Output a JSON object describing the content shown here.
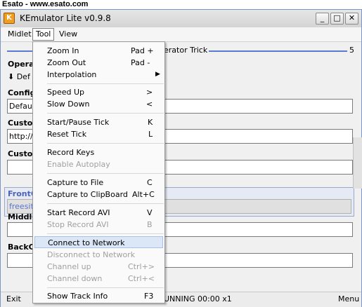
{
  "header": {
    "source": "Esato - www.esato.com"
  },
  "window": {
    "title": "KEmulator Lite v0.9.8",
    "app_icon": "K",
    "controls": {
      "minimize": "_",
      "maximize": "□",
      "close": "✕"
    }
  },
  "menubar": {
    "midlet": "Midlet",
    "tool": "Tool",
    "view": "View"
  },
  "content": {
    "slider_label": "erator Trick",
    "slider_value": "5",
    "operator_label": "Opera",
    "operator_sub": "⬇ Def",
    "config_label": "Config",
    "config_value": "Defau",
    "custom1_label": "Custon",
    "custom1_value": "http://fr",
    "custom2_label": "Custor",
    "custom2_value": "",
    "front_label": "FrontC",
    "front_value": "freesit",
    "middle_label": "Middle",
    "middle_value": "",
    "back_label": "BackC",
    "back_value": ""
  },
  "statusbar": {
    "left": "Exit",
    "center": "UNNING 00:00 x1",
    "right": "Menu"
  },
  "tool_menu": {
    "items": [
      {
        "label": "Zoom In",
        "shortcut": "Pad +"
      },
      {
        "label": "Zoom Out",
        "shortcut": "Pad -"
      },
      {
        "label": "Interpolation",
        "shortcut": ""
      },
      {
        "label": "Speed Up",
        "shortcut": ">"
      },
      {
        "label": "Slow Down",
        "shortcut": "<"
      },
      {
        "label": "Start/Pause Tick",
        "shortcut": "K"
      },
      {
        "label": "Reset Tick",
        "shortcut": "L"
      },
      {
        "label": "Record Keys",
        "shortcut": ""
      },
      {
        "label": "Enable Autoplay",
        "shortcut": ""
      },
      {
        "label": "Capture to File",
        "shortcut": "C"
      },
      {
        "label": "Capture to ClipBoard",
        "shortcut": "Alt+C"
      },
      {
        "label": "Start Record AVI",
        "shortcut": "V"
      },
      {
        "label": "Stop Record AVI",
        "shortcut": "B"
      },
      {
        "label": "Connect to Network",
        "shortcut": ""
      },
      {
        "label": "Disconnect to Network",
        "shortcut": ""
      },
      {
        "label": "Channel up",
        "shortcut": "Ctrl+>"
      },
      {
        "label": "Channel down",
        "shortcut": "Ctrl+<"
      },
      {
        "label": "Show Track Info",
        "shortcut": "F3"
      }
    ]
  },
  "colors": {
    "accent": "#5a7bd0",
    "highlight": "#dbe6f7",
    "disabled": "#a0a0a0"
  }
}
